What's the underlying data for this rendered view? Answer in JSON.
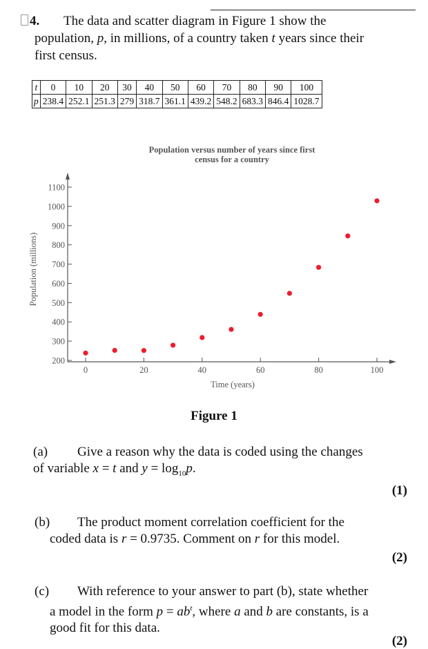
{
  "question": {
    "number": "4.",
    "intro_line1": "The data and scatter diagram in Figure 1 show the",
    "intro_line2_a": "population, ",
    "intro_var_p": "p",
    "intro_line2_b": ", in millions, of a country taken ",
    "intro_var_t": "t",
    "intro_line2_c": " years since their",
    "intro_line3": "first census."
  },
  "table": {
    "row_labels": [
      "t",
      "p"
    ],
    "t": [
      "0",
      "10",
      "20",
      "30",
      "40",
      "50",
      "60",
      "70",
      "80",
      "90",
      "100"
    ],
    "p": [
      "238.4",
      "252.1",
      "251.3",
      "279",
      "318.7",
      "361.1",
      "439.2",
      "548.2",
      "683.3",
      "846.4",
      "1028.7"
    ]
  },
  "figure_caption": "Figure 1",
  "chart_data": {
    "type": "scatter",
    "title": "Population versus number of years since first census for a country",
    "title_lines": [
      "Population versus number of years since first",
      "census for a country"
    ],
    "xlabel": "Time (years)",
    "ylabel": "Population (millions)",
    "x": [
      0,
      10,
      20,
      30,
      40,
      50,
      60,
      70,
      80,
      90,
      100
    ],
    "y": [
      238.4,
      252.1,
      251.3,
      279,
      318.7,
      361.1,
      439.2,
      548.2,
      683.3,
      846.4,
      1028.7
    ],
    "xlim": [
      -6,
      106
    ],
    "ylim": [
      200,
      1100
    ],
    "xticks": [
      0,
      20,
      40,
      60,
      80,
      100
    ],
    "yticks": [
      200,
      300,
      400,
      500,
      600,
      700,
      800,
      900,
      1000,
      1100
    ],
    "grid": false,
    "point_color": "#ee1c2e",
    "axis_color": "#555555"
  },
  "parts": [
    {
      "label": "(a)",
      "line1": "Give a reason why the data is coded using the changes",
      "line2_a": "of variable ",
      "line2_x": "x",
      "line2_b": " = ",
      "line2_t": "t",
      "line2_c": " and ",
      "line2_y": "y",
      "line2_d": " = log",
      "line2_sub": "10",
      "line2_p": "p",
      "line2_e": ".",
      "marks": "(1)"
    },
    {
      "label": "(b)",
      "line1": "The product moment correlation coefficient for the",
      "line2_a": "coded data is ",
      "line2_r": "r",
      "line2_b": " = 0.9735. Comment on ",
      "line2_r2": "r",
      "line2_c": " for this model.",
      "marks": "(2)"
    },
    {
      "label": "(c)",
      "line1": "With reference to your answer to part (b), state whether",
      "line2_a": "a model in the form ",
      "line2_p": "p",
      "line2_b": " = ",
      "line2_ab": "ab",
      "line2_sup": "t",
      "line2_c": ", where ",
      "line2_av": "a",
      "line2_d": " and ",
      "line2_bv": "b",
      "line2_e": " are constants, is a",
      "line3": "good fit for this data.",
      "marks": "(2)"
    }
  ]
}
